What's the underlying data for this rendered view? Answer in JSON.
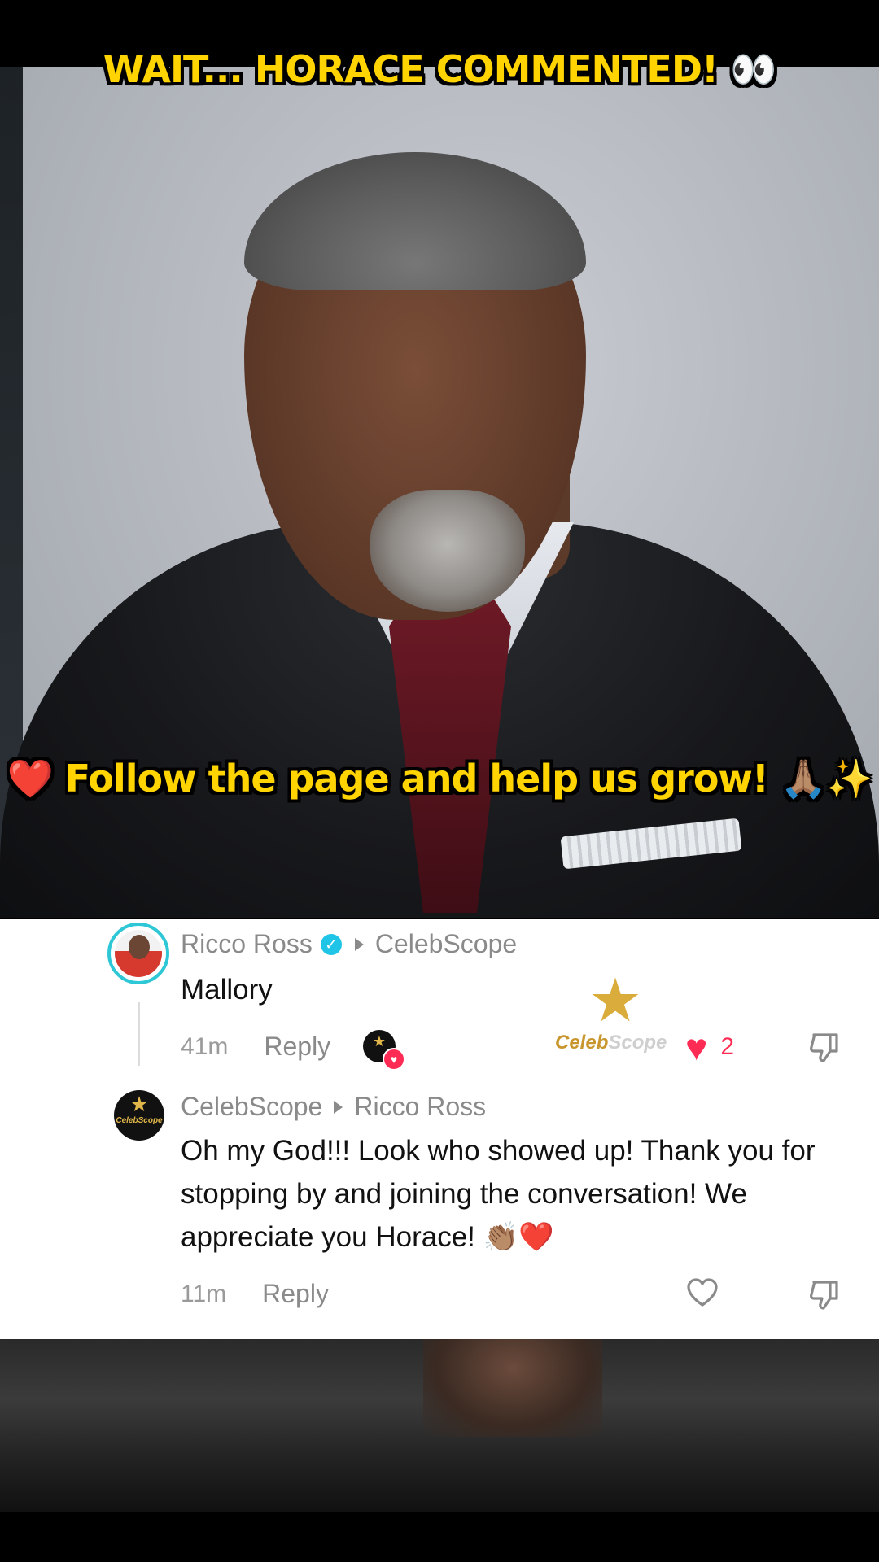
{
  "overlay": {
    "top_caption": "WAIT... HORACE COMMENTED! 👀",
    "mid_caption": "❤️ Follow the page and help us grow! 🙏🏽✨"
  },
  "comments": [
    {
      "author": "Ricco Ross",
      "verified": true,
      "reply_to": "CelebScope",
      "text": "Mallory",
      "time": "41m",
      "reply_label": "Reply",
      "likes": "2",
      "liked": true,
      "creator_liked": true
    },
    {
      "author": "CelebScope",
      "verified": false,
      "reply_to": "Ricco Ross",
      "text": "Oh my God!!! Look who showed up! Thank you for stopping by and joining the conversation! We appreciate you Horace! 👏🏽❤️",
      "time": "11m",
      "reply_label": "Reply",
      "likes": "",
      "liked": false
    }
  ],
  "watermark": {
    "logo_text_a": "Celeb",
    "logo_text_b": "Scope"
  },
  "avatar_text": {
    "celeb_small": "CelebScope"
  },
  "icons": {
    "verified": "verified-badge-icon",
    "heart": "heart-icon",
    "dislike": "thumbs-down-icon"
  },
  "colors": {
    "caption_yellow": "#ffd400",
    "like_red": "#fe2c55",
    "verified_cyan": "#20c4e6",
    "avatar_ring": "#2ec7d6"
  }
}
